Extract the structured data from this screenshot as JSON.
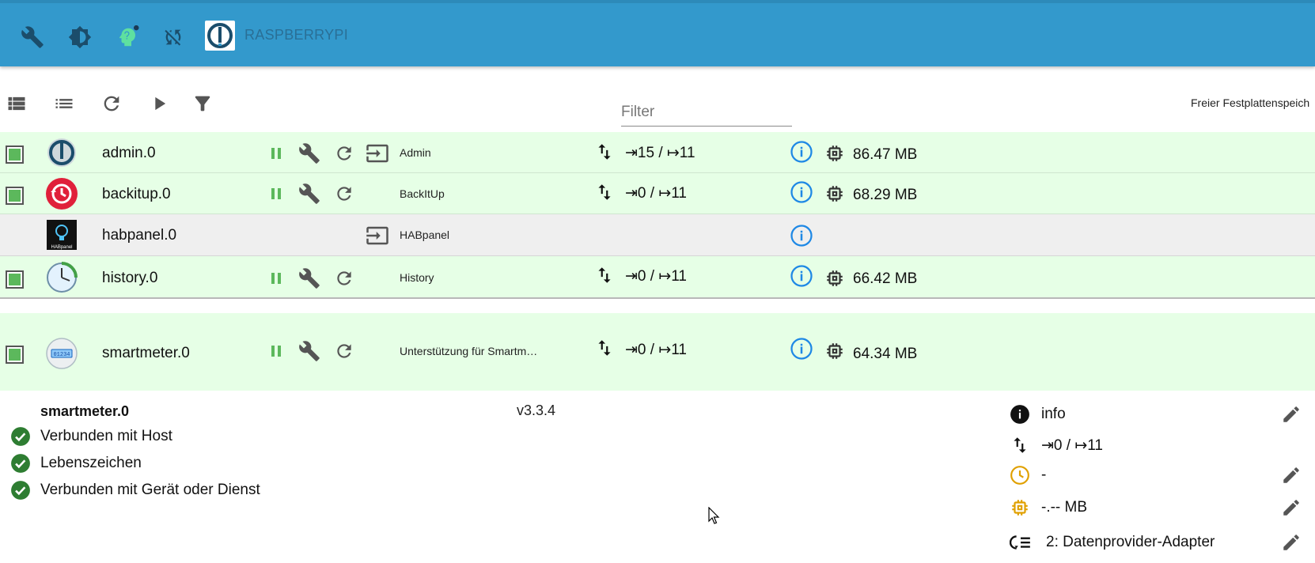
{
  "topbar": {
    "host_name": "RASPBERRYPI",
    "icons": [
      "wrench-icon",
      "brightness-icon",
      "expert-mode-icon",
      "sync-disabled-icon"
    ],
    "colors": {
      "bar": "#3399cc",
      "expert": "#5ee0a0"
    }
  },
  "toolbar": {
    "filter_placeholder": "Filter",
    "disk_label": "Freier Festplattenspeich"
  },
  "instances": [
    {
      "name": "admin.0",
      "title": "Admin",
      "logs": "⇥15 / ↦11",
      "memory": "86.47 MB",
      "enabled": true,
      "has_link": true
    },
    {
      "name": "backitup.0",
      "title": "BackItUp",
      "logs": "⇥0 / ↦11",
      "memory": "68.29 MB",
      "enabled": true,
      "has_link": false
    },
    {
      "name": "habpanel.0",
      "title": "HABpanel",
      "logs": "",
      "memory": "",
      "enabled": false,
      "has_link": true
    },
    {
      "name": "history.0",
      "title": "History",
      "logs": "⇥0 / ↦11",
      "memory": "66.42 MB",
      "enabled": true,
      "has_link": false
    },
    {
      "name": "smartmeter.0",
      "title": "Unterstützung für Smartm…",
      "logs": "⇥0 / ↦11",
      "memory": "64.34 MB",
      "enabled": true,
      "has_link": false
    }
  ],
  "habpanel_logo_text": "HABpanel",
  "smartmeter_display_text": "01234",
  "detail": {
    "name": "smartmeter.0",
    "version": "v3.3.4",
    "statuses": [
      "Verbunden mit Host",
      "Lebenszeichen",
      "Verbunden mit Gerät oder Dienst"
    ],
    "log_level": "info",
    "logs": "⇥0 / ↦11",
    "schedule": "-",
    "ram_limit": "-.-- MB",
    "tier": "2: Datenprovider-Adapter"
  },
  "colors": {
    "row_running": "#e6ffe6",
    "row_disabled": "#efefef",
    "pause_green": "#5cb85c",
    "info_blue": "#1e88e5",
    "status_green": "#2e7d32",
    "warn_orange": "#e0a000"
  }
}
